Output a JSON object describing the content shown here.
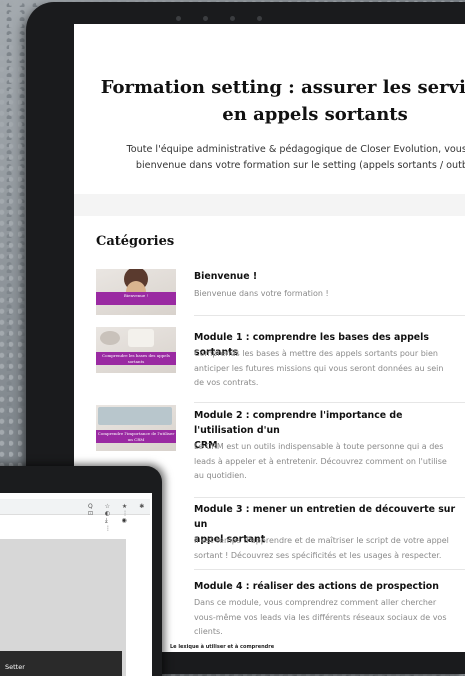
{
  "hero": {
    "title_line1": "Formation setting : assurer les services cli",
    "title_line2": "en appels sortants",
    "subtitle_line1": "Toute l'équipe administrative & pédagogique de Closer Evolution, vous souhai",
    "subtitle_line2": "bienvenue dans votre formation sur le setting (appels sortants / outbound"
  },
  "categories": {
    "heading": "Catégories",
    "items": [
      {
        "title": "Bienvenue !",
        "desc": [
          "Bienvenue dans votre formation !"
        ],
        "thumb_label": "Bienvenue !"
      },
      {
        "title": "Module 1 : comprendre les bases des appels sortants",
        "desc": [
          "Comprends les bases à mettre des appels sortants pour bien",
          "anticiper les futures missions qui vous seront données au sein",
          "de vos contrats."
        ],
        "thumb_label": "Comprendre les bases des appels sortants"
      },
      {
        "title": "Module 2 : comprendre l'importance de l'utilisation d'un",
        "title2": "CRM",
        "desc": [
          "Le CRM est un outils indispensable à toute personne qui a des",
          "leads à appeler et à entretenir. Découvrez comment on l'utilise",
          "au quotidien."
        ],
        "thumb_label": "Comprendre l'importance de l'utiliser un CRM"
      },
      {
        "title": "Module 3 : mener un entretien de découverte sur un",
        "title2": "appel sortant",
        "desc": [
          "Il est temps d'apprendre et de maîtriser le script de votre appel",
          "sortant ! Découvrez ses spécificités et les usages à respecter."
        ]
      },
      {
        "title": "Module 4 : réaliser des actions de prospection",
        "desc": [
          "Dans ce module, vous comprendrez comment aller chercher",
          "vous-même vos leads via les différents réseaux sociaux de vos",
          "clients."
        ]
      }
    ],
    "bottom_label": "Le lexique à utiliser et à comprendre"
  },
  "laptop": {
    "setter_label": "Setter",
    "toolbar_icons": "Q ☆ ★ ✱ ⊡ ◐ ⋮",
    "toolbar_icons2": "⤓ ◉ ⋮"
  },
  "colors": {
    "accent_purple": "#9a2aa2",
    "text_dark": "#111111",
    "text_muted": "#8a8a8a"
  }
}
